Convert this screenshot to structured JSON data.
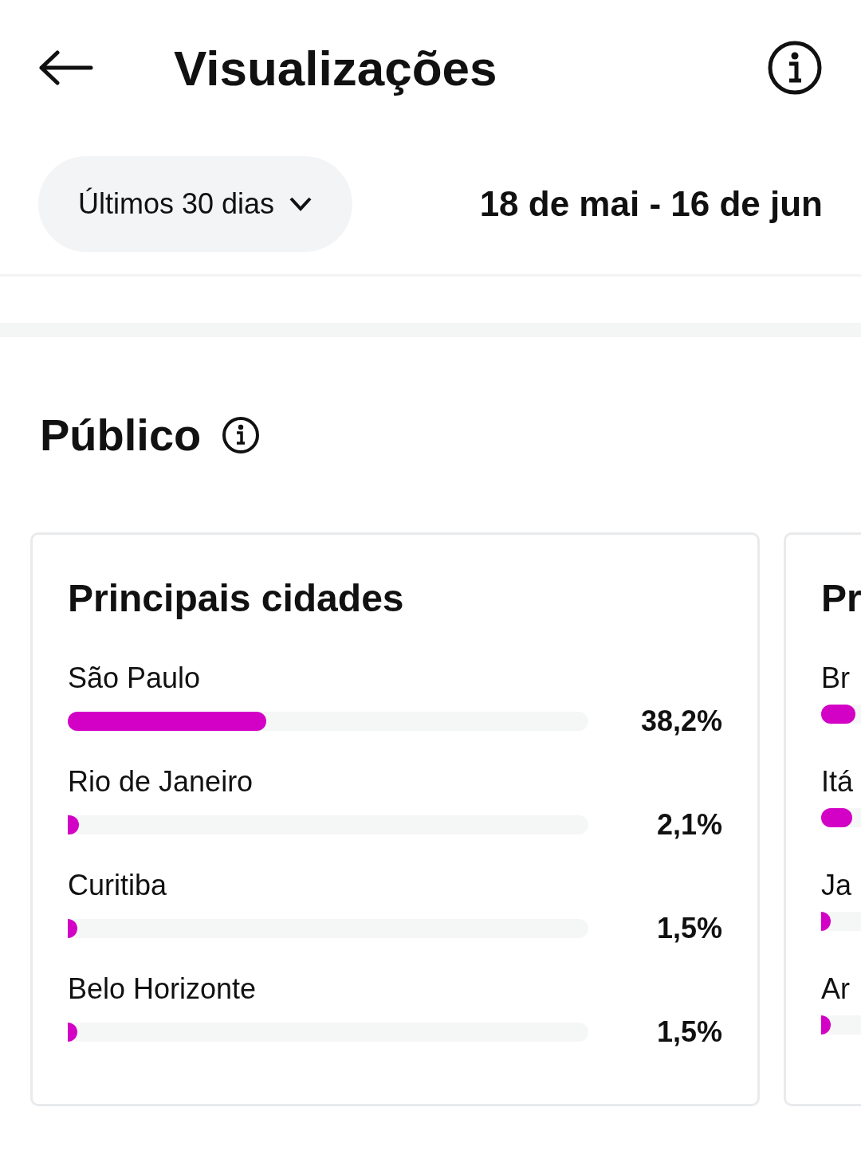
{
  "header": {
    "title": "Visualizações"
  },
  "filter": {
    "period": "Últimos 30 dias",
    "range": "18 de mai - 16 de jun"
  },
  "section": {
    "title": "Público"
  },
  "cards": [
    {
      "title": "Principais cidades",
      "items": [
        {
          "label": "São Paulo",
          "level": 0.382,
          "reading": "38,2%"
        },
        {
          "label": "Rio de Janeiro",
          "level": 0.021,
          "reading": "2,1%"
        },
        {
          "label": "Curitiba",
          "level": 0.015,
          "reading": "1,5%"
        },
        {
          "label": "Belo Horizonte",
          "level": 0.015,
          "reading": "1,5%"
        }
      ]
    },
    {
      "title": "Pr",
      "items": [
        {
          "label": "Br",
          "level": 0.066
        },
        {
          "label": "Itá",
          "level": 0.06
        },
        {
          "label": "Ja",
          "level": 0.015
        },
        {
          "label": "Ar",
          "level": 0.015
        }
      ]
    }
  ]
}
